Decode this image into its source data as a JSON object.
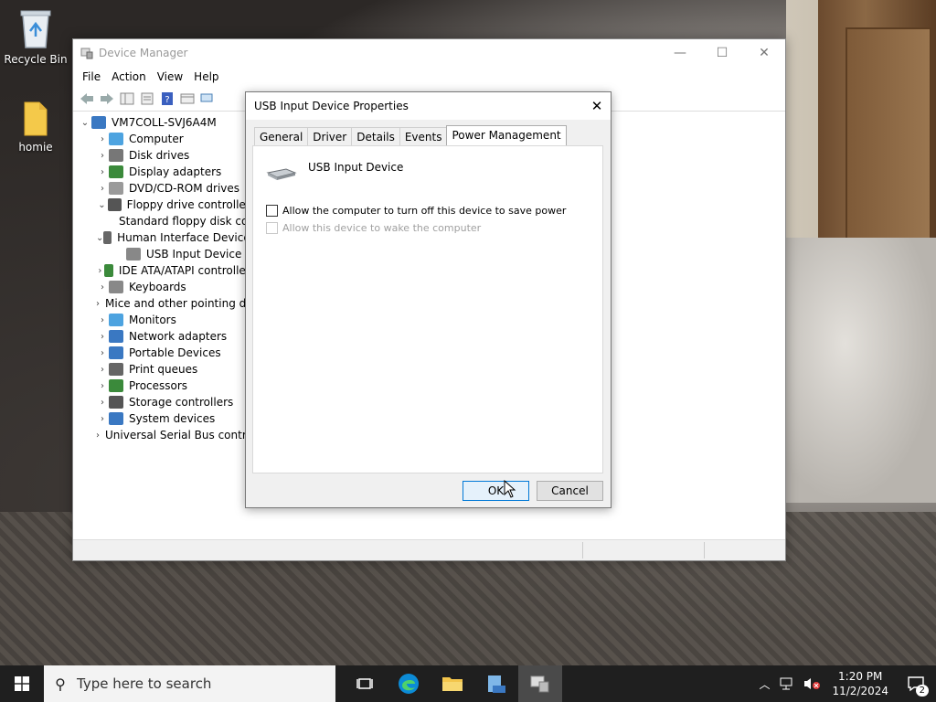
{
  "desktop": {
    "icons": [
      {
        "label": "Recycle Bin",
        "icon": "recycle-bin-icon"
      },
      {
        "label": "homie",
        "icon": "folder-icon"
      }
    ]
  },
  "device_manager": {
    "title": "Device Manager",
    "menu": [
      "File",
      "Action",
      "View",
      "Help"
    ],
    "tree": [
      {
        "label": "VM7COLL-SVJ6A4M",
        "level": 0,
        "expander": "⌄",
        "icon": "computer-icon",
        "color": "#3a78c2"
      },
      {
        "label": "Computer",
        "level": 1,
        "expander": "›",
        "icon": "monitor-icon",
        "color": "#4da3e0"
      },
      {
        "label": "Disk drives",
        "level": 1,
        "expander": "›",
        "icon": "disk-icon",
        "color": "#777777"
      },
      {
        "label": "Display adapters",
        "level": 1,
        "expander": "›",
        "icon": "display-adapter-icon",
        "color": "#3b8a3b"
      },
      {
        "label": "DVD/CD-ROM drives",
        "level": 1,
        "expander": "›",
        "icon": "dvd-icon",
        "color": "#9a9a9a"
      },
      {
        "label": "Floppy drive controllers",
        "level": 1,
        "expander": "⌄",
        "icon": "floppy-controller-icon",
        "color": "#555555"
      },
      {
        "label": "Standard floppy disk controller",
        "level": 2,
        "expander": "",
        "icon": "warning-device-icon",
        "color": "#e0a800"
      },
      {
        "label": "Human Interface Devices",
        "level": 1,
        "expander": "⌄",
        "icon": "hid-icon",
        "color": "#666666"
      },
      {
        "label": "USB Input Device",
        "level": 2,
        "expander": "",
        "icon": "usb-input-icon",
        "color": "#888888"
      },
      {
        "label": "IDE ATA/ATAPI controllers",
        "level": 1,
        "expander": "›",
        "icon": "ide-icon",
        "color": "#3b8a3b"
      },
      {
        "label": "Keyboards",
        "level": 1,
        "expander": "›",
        "icon": "keyboard-icon",
        "color": "#888888"
      },
      {
        "label": "Mice and other pointing devices",
        "level": 1,
        "expander": "›",
        "icon": "mouse-icon",
        "color": "#555555"
      },
      {
        "label": "Monitors",
        "level": 1,
        "expander": "›",
        "icon": "monitor-icon",
        "color": "#4da3e0"
      },
      {
        "label": "Network adapters",
        "level": 1,
        "expander": "›",
        "icon": "network-icon",
        "color": "#3a78c2"
      },
      {
        "label": "Portable Devices",
        "level": 1,
        "expander": "›",
        "icon": "portable-device-icon",
        "color": "#3a78c2"
      },
      {
        "label": "Print queues",
        "level": 1,
        "expander": "›",
        "icon": "printer-icon",
        "color": "#666666"
      },
      {
        "label": "Processors",
        "level": 1,
        "expander": "›",
        "icon": "processor-icon",
        "color": "#3b8a3b"
      },
      {
        "label": "Storage controllers",
        "level": 1,
        "expander": "›",
        "icon": "storage-controller-icon",
        "color": "#555555"
      },
      {
        "label": "System devices",
        "level": 1,
        "expander": "›",
        "icon": "system-device-icon",
        "color": "#3a78c2"
      },
      {
        "label": "Universal Serial Bus controllers",
        "level": 1,
        "expander": "›",
        "icon": "usb-icon",
        "color": "#444444"
      }
    ]
  },
  "dialog": {
    "title": "USB Input Device Properties",
    "tabs": [
      "General",
      "Driver",
      "Details",
      "Events",
      "Power Management"
    ],
    "active_tab": "Power Management",
    "device_name": "USB Input Device",
    "options": [
      {
        "label": "Allow the computer to turn off this device to save power",
        "checked": false,
        "enabled": true
      },
      {
        "label": "Allow this device to wake the computer",
        "checked": false,
        "enabled": false
      }
    ],
    "ok_label": "OK",
    "cancel_label": "Cancel"
  },
  "taskbar": {
    "search_placeholder": "Type here to search",
    "apps": [
      "task-view-icon",
      "edge-icon",
      "file-explorer-icon",
      "server-manager-icon",
      "device-manager-icon"
    ],
    "time": "1:20 PM",
    "date": "11/2/2024",
    "notification_count": "2"
  }
}
